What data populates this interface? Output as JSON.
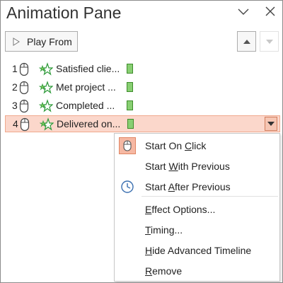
{
  "pane": {
    "title": "Animation Pane",
    "collapse_icon": "chevron-down-icon",
    "close_icon": "close-icon"
  },
  "toolbar": {
    "play_label": "Play From",
    "move_up_icon": "triangle-up-icon",
    "move_down_icon": "triangle-down-icon"
  },
  "animations": [
    {
      "number": "1",
      "name": "Satisfied clie...",
      "trigger": "mouse-click-icon",
      "effect": "star-effect-icon",
      "selected": false
    },
    {
      "number": "2",
      "name": "Met project ...",
      "trigger": "mouse-click-icon",
      "effect": "star-effect-icon",
      "selected": false
    },
    {
      "number": "3",
      "name": "Completed ...",
      "trigger": "mouse-click-icon",
      "effect": "star-effect-icon",
      "selected": false
    },
    {
      "number": "4",
      "name": "Delivered on...",
      "trigger": "mouse-click-icon",
      "effect": "star-effect-icon",
      "selected": true
    }
  ],
  "colors": {
    "selected_row_bg": "#fbd7cb",
    "selected_row_border": "#f0a98e",
    "timeline_bar": "#88cf72",
    "effect_star": "#2e9a3a"
  },
  "context_menu": {
    "items": [
      {
        "label": "Start On Click",
        "accel": "C",
        "icon": "mouse-click-icon",
        "checked": true
      },
      {
        "label": "Start With Previous",
        "accel": "W",
        "icon": "",
        "checked": false
      },
      {
        "label": "Start After Previous",
        "accel": "A",
        "icon": "clock-icon",
        "checked": false
      },
      {
        "label": "Effect Options...",
        "accel": "E"
      },
      {
        "label": "Timing...",
        "accel": "T"
      },
      {
        "label": "Hide Advanced Timeline",
        "accel": "H"
      },
      {
        "label": "Remove",
        "accel": "R"
      }
    ]
  }
}
